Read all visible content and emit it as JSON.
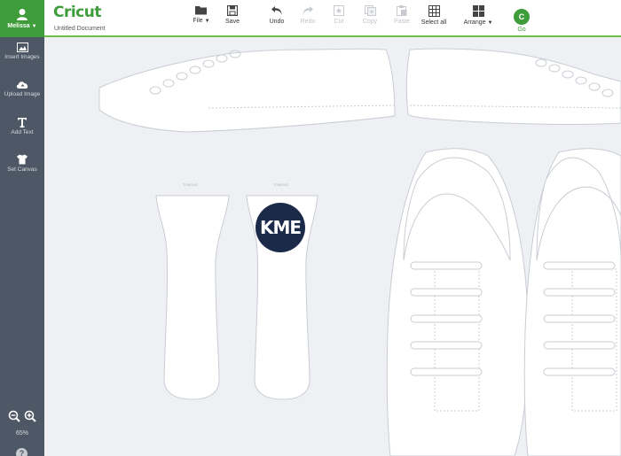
{
  "sidebar": {
    "user_name": "Melissa",
    "items": [
      {
        "label": "Insert Images",
        "icon": "image-icon"
      },
      {
        "label": "Upload Image",
        "icon": "upload-cloud-icon"
      },
      {
        "label": "Add Text",
        "icon": "text-icon"
      },
      {
        "label": "Set Canvas",
        "icon": "tshirt-icon"
      }
    ],
    "zoom_level": "65%",
    "help_label": "?"
  },
  "header": {
    "logo": "Cricut",
    "document_title": "Untitled Document",
    "tools": {
      "file": "File",
      "save": "Save",
      "undo": "Undo",
      "redo": "Redo",
      "cut": "Cut",
      "copy": "Copy",
      "paste": "Paste",
      "select_all": "Select all",
      "arrange": "Arrange"
    },
    "go_label": "Go",
    "go_icon_text": "C"
  },
  "canvas": {
    "monogram": "KME",
    "tongue_label_left": "TONGUE",
    "tongue_label_right": "TONGUE"
  },
  "colors": {
    "accent": "#3e9c3a",
    "sidebar_bg": "#4e5765",
    "canvas_bg": "#eef0f3",
    "monogram": "#1c2a4a"
  }
}
